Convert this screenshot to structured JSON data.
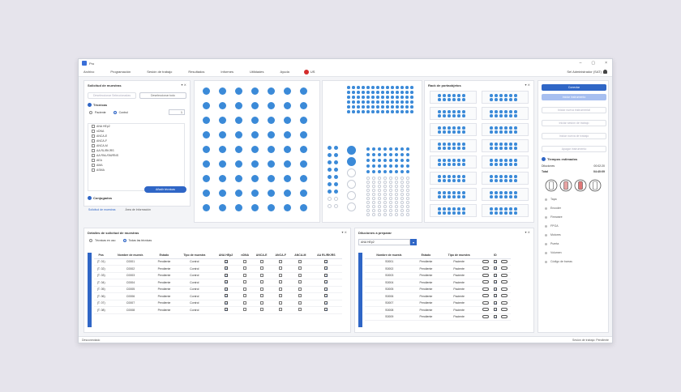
{
  "window": {
    "title": "Pro",
    "menu": [
      "Archivo",
      "Programación",
      "Sesión de trabajo",
      "Resultados",
      "Informes",
      "Utilidades",
      "Ayuda"
    ],
    "language": "US",
    "user": "Sel Administrador (SAT)",
    "controls": [
      "–",
      "▢",
      "×"
    ]
  },
  "sample_request": {
    "title": "Solicitud de muestras",
    "deselect_selected": "Deseleccionar Seleccionadas",
    "deselect_all": "Deseleccionar todo",
    "techniques_label": "Técnicas",
    "patient_label": "Paciente",
    "control_label": "Control",
    "count": "1",
    "techniques": [
      "ANA HEp2",
      "nDNA",
      "ANCA-E",
      "ANCA-F",
      "ANCA-M",
      "AA RL/RK/RS",
      "AA RNL/SM/RNS",
      "AEA",
      "AMA",
      "ASMA"
    ],
    "add_techniques": "Añadir técnicas",
    "grouped_label": "Conjugados",
    "tab_request": "Solicitud de muestras",
    "tab_info": "Área de Información"
  },
  "reagent_rack": {
    "title": "Rack de portaobjetos"
  },
  "sample_details": {
    "title": "Detalles de solicitud de muestras",
    "option_used": "Técnicas en uso",
    "option_all": "Todas las técnicas",
    "columns": [
      "Pos",
      "Nombre de muestr.",
      "Estado",
      "Tipo de muestra",
      "ANA HEp2",
      "nDNA",
      "ANCA-E",
      "ANCA-F",
      "ANCA-M",
      "AA RL/RK/RS"
    ],
    "rows": [
      {
        "pos": "(T. 01)",
        "name": "C0001",
        "state": "Pendiente",
        "type": "Control",
        "checks": [
          true,
          false,
          false,
          false,
          false,
          true
        ]
      },
      {
        "pos": "(T. 02)",
        "name": "C0002",
        "state": "Pendiente",
        "type": "Control",
        "checks": [
          true,
          false,
          false,
          false,
          false,
          true
        ]
      },
      {
        "pos": "(T. 03)",
        "name": "C0003",
        "state": "Pendiente",
        "type": "Control",
        "checks": [
          true,
          false,
          false,
          false,
          false,
          true
        ]
      },
      {
        "pos": "(T. 04)",
        "name": "C0004",
        "state": "Pendiente",
        "type": "Control",
        "checks": [
          true,
          false,
          false,
          false,
          false,
          true
        ]
      },
      {
        "pos": "(T. 05)",
        "name": "C0005",
        "state": "Pendiente",
        "type": "Control",
        "checks": [
          true,
          false,
          false,
          false,
          false,
          true
        ]
      },
      {
        "pos": "(T. 06)",
        "name": "C0006",
        "state": "Pendiente",
        "type": "Control",
        "checks": [
          true,
          false,
          false,
          false,
          false,
          true
        ]
      },
      {
        "pos": "(T. 07)",
        "name": "C0007",
        "state": "Pendiente",
        "type": "Control",
        "checks": [
          true,
          false,
          false,
          false,
          false,
          true
        ]
      },
      {
        "pos": "(T. 08)",
        "name": "C0008",
        "state": "Pendiente",
        "type": "Control",
        "checks": [
          true,
          false,
          false,
          false,
          false,
          true
        ]
      }
    ]
  },
  "dilutions": {
    "title": "Diluciones a preparar",
    "selected_technique": "ANA HEp2",
    "columns": [
      "Nombre de muestr.",
      "Estado",
      "Tipo de muestra",
      "",
      "ID",
      ""
    ],
    "rows": [
      {
        "name": "S0001",
        "state": "Pendiente",
        "type": "Paciente"
      },
      {
        "name": "S0002",
        "state": "Pendiente",
        "type": "Paciente"
      },
      {
        "name": "S0003",
        "state": "Pendiente",
        "type": "Paciente"
      },
      {
        "name": "S0004",
        "state": "Pendiente",
        "type": "Paciente"
      },
      {
        "name": "S0005",
        "state": "Pendiente",
        "type": "Paciente"
      },
      {
        "name": "S0006",
        "state": "Pendiente",
        "type": "Paciente"
      },
      {
        "name": "S0007",
        "state": "Pendiente",
        "type": "Paciente"
      },
      {
        "name": "S0008",
        "state": "Pendiente",
        "type": "Paciente"
      },
      {
        "name": "S0009",
        "state": "Pendiente",
        "type": "Paciente"
      }
    ]
  },
  "actions": {
    "connect": "Conectar",
    "start_instrument": "Iniciar instrumento",
    "buttons_disabled": [
      "Iniciar nueva instrumental",
      "Iniciar sesión de trabajo",
      "Iniciar nueva de trabajo",
      "Apagar instrumento"
    ]
  },
  "estimated": {
    "title": "Tiempos estimados",
    "rows": [
      {
        "label": "Diluciones",
        "value": "00:02:20"
      },
      {
        "label": "Total",
        "value": "04:40:09"
      }
    ],
    "legend": [
      "Tapa",
      "Encoder",
      "Firmware",
      "FPGA",
      "Motores",
      "Puerta",
      "Volumen",
      "Código de barras"
    ]
  },
  "status": {
    "left": "Desconectado",
    "right": "Sesión de trabajo: Pendiente"
  }
}
